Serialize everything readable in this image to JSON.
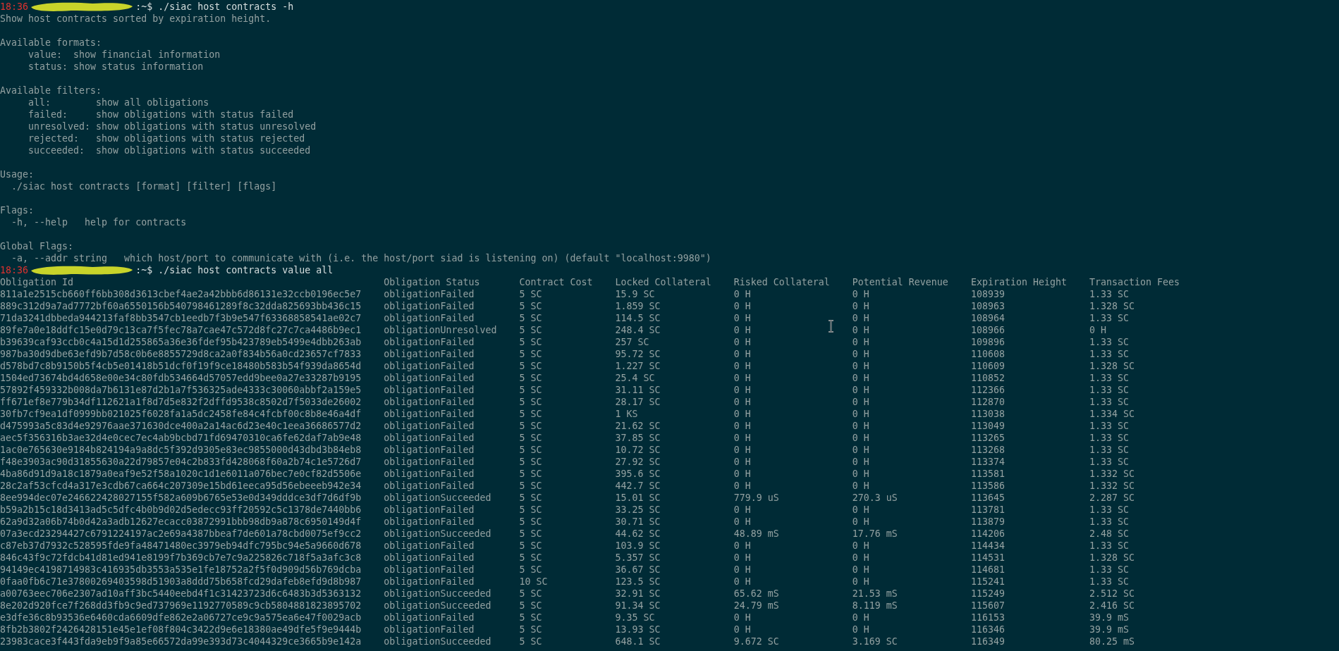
{
  "prompt_1": {
    "time": "18:36",
    "command": ":~$ ./siac host contracts -h"
  },
  "help_blocks": [
    [
      "Show host contracts sorted by expiration height."
    ],
    [
      "Available formats:",
      "     value:  show financial information",
      "     status: show status information"
    ],
    [
      "Available filters:",
      "     all:        show all obligations",
      "     failed:     show obligations with status failed",
      "     unresolved: show obligations with status unresolved",
      "     rejected:   show obligations with status rejected",
      "     succeeded:  show obligations with status succeeded"
    ],
    [
      "Usage:",
      "  ./siac host contracts [format] [filter] [flags]"
    ],
    [
      "Flags:",
      "  -h, --help   help for contracts"
    ],
    [
      "Global Flags:",
      "  -a, --addr string   which host/port to communicate with (i.e. the host/port siad is listening on) (default \"localhost:9980\")"
    ]
  ],
  "prompt_2": {
    "time": "18:36",
    "command": ":~$ ./siac host contracts value all"
  },
  "table": {
    "columns": [
      "Obligation Id",
      "Obligation Status",
      "Contract Cost",
      "Locked Collateral",
      "Risked Collateral",
      "Potential Revenue",
      "Expiration Height",
      "Transaction Fees"
    ],
    "rows": [
      [
        "811a1e2515cb660ff6bb308d3613cbef4ae2a42bbb6d86131e32ccb0196ec5e7",
        "obligationFailed",
        "5 SC",
        "15.9 SC",
        "0 H",
        "0 H",
        "108939",
        "1.33 SC"
      ],
      [
        "889c312d9a7ad7772bf60a6550156b540798461289f8c32dda825693bb436c15",
        "obligationFailed",
        "5 SC",
        "1.859 SC",
        "0 H",
        "0 H",
        "108963",
        "1.328 SC"
      ],
      [
        "71da3241dbbeda944213faf8bb3547cb1eedb7f3b9e547f63368858541ae02c7",
        "obligationFailed",
        "5 SC",
        "114.5 SC",
        "0 H",
        "0 H",
        "108964",
        "1.33 SC"
      ],
      [
        "89fe7a0e18ddfc15e0d79c13ca7f5fec78a7cae47c572d8fc27c7ca4486b9ec1",
        "obligationUnresolved",
        "5 SC",
        "248.4 SC",
        "0 H",
        "0 H",
        "108966",
        "0 H"
      ],
      [
        "b39639caf93ccb0c4a15d1d255865a36e36fdef95b423789eb5499e4dbb263ab",
        "obligationFailed",
        "5 SC",
        "257 SC",
        "0 H",
        "0 H",
        "109896",
        "1.33 SC"
      ],
      [
        "987ba30d9dbe63efd9b7d58c0b6e8855729d8ca2a0f834b56a0cd23657cf7833",
        "obligationFailed",
        "5 SC",
        "95.72 SC",
        "0 H",
        "0 H",
        "110608",
        "1.33 SC"
      ],
      [
        "d578bd7c8b9150b5f4cb5e01418b51dcf0f19f9ce18480b583b54f939da8654d",
        "obligationFailed",
        "5 SC",
        "1.227 SC",
        "0 H",
        "0 H",
        "110609",
        "1.328 SC"
      ],
      [
        "1504ed73674bd4d658e00e34c80fdb534664d57057edd9bee0a27e33287b9195",
        "obligationFailed",
        "5 SC",
        "25.4 SC",
        "0 H",
        "0 H",
        "110852",
        "1.33 SC"
      ],
      [
        "57892f459332b008da7b6131e87d2b1a7f536325ade4333c30060abbf2a159e5",
        "obligationFailed",
        "5 SC",
        "31.11 SC",
        "0 H",
        "0 H",
        "112366",
        "1.33 SC"
      ],
      [
        "ff671ef8e779b34df112621a1f8d7d5e832f2dffd9538c8502d7f5033de26002",
        "obligationFailed",
        "5 SC",
        "28.17 SC",
        "0 H",
        "0 H",
        "112870",
        "1.33 SC"
      ],
      [
        "30fb7cf9ea1df0999bb021025f6028fa1a5dc2458fe84c4fcbf00c8b8e46a4df",
        "obligationFailed",
        "5 SC",
        "1 KS",
        "0 H",
        "0 H",
        "113038",
        "1.334 SC"
      ],
      [
        "d475993a5c83d4e92976aae371630dce400a2a14ac6d23e40c1eea36686577d2",
        "obligationFailed",
        "5 SC",
        "21.62 SC",
        "0 H",
        "0 H",
        "113049",
        "1.33 SC"
      ],
      [
        "aec5f356316b3ae32d4e0cec7ec4ab9bcbd71fd69470310ca6fe62daf7ab9e48",
        "obligationFailed",
        "5 SC",
        "37.85 SC",
        "0 H",
        "0 H",
        "113265",
        "1.33 SC"
      ],
      [
        "1ac0e765630e9184b824194a9a8dc5f392d9305e83ec9855000d43dbd3b84eb8",
        "obligationFailed",
        "5 SC",
        "10.72 SC",
        "0 H",
        "0 H",
        "113268",
        "1.33 SC"
      ],
      [
        "f48e3903ac90d31855630a22d79857e04c2b833fd428068f60a2b74c1e5726d7",
        "obligationFailed",
        "5 SC",
        "27.92 SC",
        "0 H",
        "0 H",
        "113374",
        "1.33 SC"
      ],
      [
        "4ba86d91d9a18c1879a0eaf9e52f58a1020c1d1e6011a076bec7e0cf82d5506e",
        "obligationFailed",
        "5 SC",
        "395.6 SC",
        "0 H",
        "0 H",
        "113581",
        "1.332 SC"
      ],
      [
        "28c2af53cfcd4a317e3cdb67ca664c207309e15bd61eeca95d56ebeeeb942e34",
        "obligationFailed",
        "5 SC",
        "442.7 SC",
        "0 H",
        "0 H",
        "113586",
        "1.332 SC"
      ],
      [
        "8ee994dec07e246622428027155f582a609b6765e53e0d349dddce3df7d6df9b",
        "obligationSucceeded",
        "5 SC",
        "15.01 SC",
        "779.9 uS",
        "270.3 uS",
        "113645",
        "2.287 SC"
      ],
      [
        "b59a2b15c18d3413ad5c5dfc4b0b9d02d5edecc93ff20592c5c1378de7440bb6",
        "obligationFailed",
        "5 SC",
        "33.25 SC",
        "0 H",
        "0 H",
        "113781",
        "1.33 SC"
      ],
      [
        "62a9d32a06b74b0d42a3adb12627ecacc03872991bbb98db9a878c6950149d4f",
        "obligationFailed",
        "5 SC",
        "30.71 SC",
        "0 H",
        "0 H",
        "113879",
        "1.33 SC"
      ],
      [
        "07a3ecd23294427c6791224197ac2e69a4387bbeaf7de601a78cbd0075ef9cc2",
        "obligationSucceeded",
        "5 SC",
        "44.62 SC",
        "48.89 mS",
        "17.76 mS",
        "114206",
        "2.48 SC"
      ],
      [
        "c87eb37d7932c528595fde9fa48471480ec3979eb94dfc795bc94e5a9660d678",
        "obligationFailed",
        "5 SC",
        "103.9 SC",
        "0 H",
        "0 H",
        "114434",
        "1.33 SC"
      ],
      [
        "846c43f9c72fdcb41d81ed941e8199f7b369cb7e7c9a225826c718f5a3afc3c8",
        "obligationFailed",
        "5 SC",
        "5.357 SC",
        "0 H",
        "0 H",
        "114531",
        "1.328 SC"
      ],
      [
        "94149ec4198714983c416935db3553a535e1fe18752a2f5f0d909d56b769dcba",
        "obligationFailed",
        "5 SC",
        "36.67 SC",
        "0 H",
        "0 H",
        "114681",
        "1.33 SC"
      ],
      [
        "0faa0fb6c71e37800269403598d51903a8ddd75b658fcd29dafeb8efd9d8b987",
        "obligationFailed",
        "10 SC",
        "123.5 SC",
        "0 H",
        "0 H",
        "115241",
        "1.33 SC"
      ],
      [
        "a00763eec706e2307ad10aff3bc5440eebd4f1c31423723d6c6483b3d5363132",
        "obligationSucceeded",
        "5 SC",
        "32.91 SC",
        "65.62 mS",
        "21.53 mS",
        "115249",
        "2.512 SC"
      ],
      [
        "8e202d920fce7f268dd3fb9c9ed737969e1192770589c9cb5804881823895702",
        "obligationSucceeded",
        "5 SC",
        "91.34 SC",
        "24.79 mS",
        "8.119 mS",
        "115607",
        "2.416 SC"
      ],
      [
        "e3dfe36c8b93536e6460cda6609dfe862e2a06727ce9c9a575ea6e47f0029acb",
        "obligationFailed",
        "5 SC",
        "9.35 SC",
        "0 H",
        "0 H",
        "116153",
        "39.9 mS"
      ],
      [
        "8fb2b3802f2426428151e45e1ef08f804c3422d9e6e18380ae49dfe5f9e9444b",
        "obligationFailed",
        "5 SC",
        "13.93 SC",
        "0 H",
        "0 H",
        "116346",
        "39.9 mS"
      ],
      [
        "23983cace3f443fda9eb9f9a85e66572da99e393d73c4044329ce3665b9e142a",
        "obligationSucceeded",
        "5 SC",
        "648.1 SC",
        "9.672 SC",
        "3.169 SC",
        "116349",
        "80.25 mS"
      ]
    ]
  }
}
